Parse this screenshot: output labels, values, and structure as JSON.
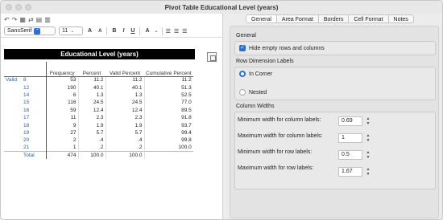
{
  "window": {
    "title": "Pivot Table Educational Level (years)"
  },
  "toolbar": {
    "font_name": "SansSerif",
    "font_size": "11",
    "bold": "B",
    "italic": "I",
    "underline": "U",
    "grow": "A",
    "shrink": "A",
    "color": "A"
  },
  "pivot": {
    "title": "Educational Level (years)",
    "headers": [
      "Frequency",
      "Percent",
      "Valid Percent",
      "Cumulative Percent"
    ],
    "row_group": "Valid",
    "rows": [
      [
        "8",
        "53",
        "11.2",
        "11.2",
        "11.2"
      ],
      [
        "12",
        "190",
        "40.1",
        "40.1",
        "51.3"
      ],
      [
        "14",
        "6",
        "1.3",
        "1.3",
        "52.5"
      ],
      [
        "15",
        "116",
        "24.5",
        "24.5",
        "77.0"
      ],
      [
        "16",
        "59",
        "12.4",
        "12.4",
        "89.5"
      ],
      [
        "17",
        "11",
        "2.3",
        "2.3",
        "91.8"
      ],
      [
        "18",
        "9",
        "1.9",
        "1.9",
        "93.7"
      ],
      [
        "19",
        "27",
        "5.7",
        "5.7",
        "99.4"
      ],
      [
        "20",
        "2",
        ".4",
        ".4",
        "99.8"
      ],
      [
        "21",
        "1",
        ".2",
        ".2",
        "100.0"
      ],
      [
        "Total",
        "474",
        "100.0",
        "100.0",
        ""
      ]
    ]
  },
  "tabs": [
    "General",
    "Area Format",
    "Borders",
    "Cell Format",
    "Notes"
  ],
  "general": {
    "section_general": "General",
    "hide_empty_label": "Hide empty rows and columns",
    "section_row_dim": "Row Dimension Labels",
    "in_corner_label": "In Corner",
    "nested_label": "Nested",
    "section_widths": "Column Widths",
    "min_col_label": "Minimum width for column labels:",
    "min_col_value": "0.69",
    "max_col_label": "Maximum width for column labels:",
    "max_col_value": "1",
    "min_row_label": "Minimum width for row labels:",
    "min_row_value": "0.5",
    "max_row_label": "Maximum width for row labels:",
    "max_row_value": "1.67"
  },
  "colors": {
    "accent": "#2b6fd6",
    "title_bar": "#000000",
    "row_label": "#2b5fa8"
  }
}
